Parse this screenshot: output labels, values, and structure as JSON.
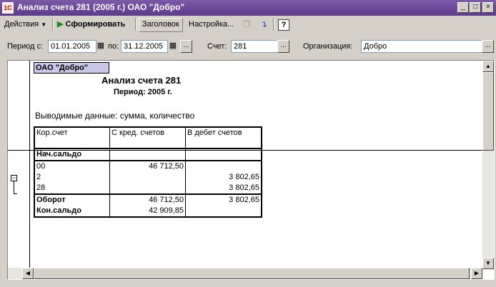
{
  "window": {
    "title": "Анализ счета 281 (2005 г.) ОАО \"Добро\"",
    "min": "_",
    "max": "□",
    "close": "×"
  },
  "toolbar": {
    "actions": "Действия",
    "generate": "Сформировать",
    "header": "Заголовок",
    "settings": "Настройка...",
    "help": "?"
  },
  "params": {
    "period_from_label": "Период с:",
    "period_from": "01.01.2005",
    "period_to_label": "по:",
    "period_to": "31.12.2005",
    "account_label": "Счет:",
    "account": "281",
    "org_label": "Организация:",
    "org": "Добро",
    "ellipsis": "..."
  },
  "report": {
    "org_cell": "ОАО \"Добро\"",
    "title": "Анализ счета 281",
    "period": "Период: 2005 г.",
    "note": "Выводимые данные: сумма, количество",
    "columns": [
      "Кор.счет",
      "С кред. счетов",
      "В дебет счетов"
    ],
    "opening": "Нач.сальдо",
    "rows": [
      {
        "account": "00",
        "credit": "46 712,50",
        "debit": ""
      },
      {
        "account": "2",
        "credit": "",
        "debit": "3 802,65"
      },
      {
        "account": "28",
        "credit": "",
        "debit": "3 802,65"
      }
    ],
    "turnover": {
      "label": "Оборот",
      "credit": "46 712,50",
      "debit": "3 802,65"
    },
    "closing": {
      "label": "Кон.сальдо",
      "credit": "42 909,85",
      "debit": ""
    }
  }
}
